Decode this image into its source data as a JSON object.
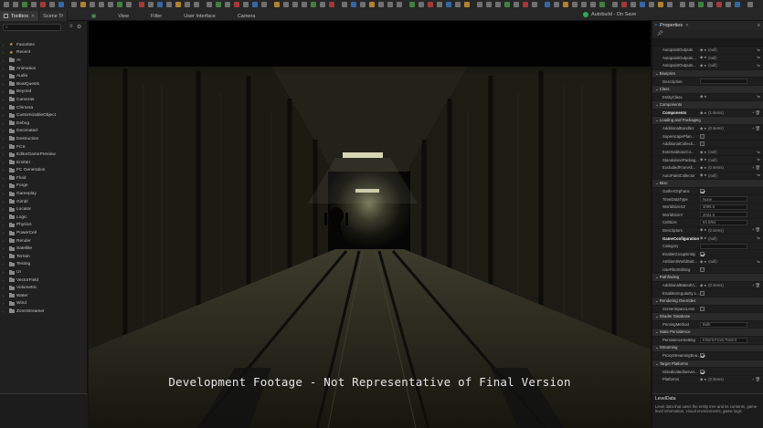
{
  "toolbar": {
    "viewport_menu": [
      "View",
      "Filter",
      "User Interface",
      "Camera"
    ],
    "autobuild": "Autobuild - On Save"
  },
  "toolbox": {
    "tabs": [
      "Toolbox",
      "Scene Tr"
    ],
    "items": [
      {
        "label": "Favorites",
        "icon": "star-icon"
      },
      {
        "label": "Recent",
        "icon": "star-icon"
      },
      {
        "label": "AI",
        "icon": "folder-icon"
      },
      {
        "label": "Animation",
        "icon": "folder-icon"
      },
      {
        "label": "Audio",
        "icon": "folder-icon"
      },
      {
        "label": "BeatQuests",
        "icon": "folder-icon"
      },
      {
        "label": "Beyond",
        "icon": "folder-icon"
      },
      {
        "label": "Cameras",
        "icon": "folder-icon"
      },
      {
        "label": "Chimera",
        "icon": "folder-icon"
      },
      {
        "label": "CustomizableObject",
        "icon": "folder-icon"
      },
      {
        "label": "Debug",
        "icon": "folder-icon"
      },
      {
        "label": "Decimated",
        "icon": "folder-icon"
      },
      {
        "label": "Destruction",
        "icon": "folder-icon"
      },
      {
        "label": "FCS",
        "icon": "folder-icon"
      },
      {
        "label": "EditorGamePreview",
        "icon": "folder-icon"
      },
      {
        "label": "Emitter",
        "icon": "folder-icon"
      },
      {
        "label": "FC Generation",
        "icon": "folder-icon"
      },
      {
        "label": "Fluid",
        "icon": "folder-icon"
      },
      {
        "label": "Forge",
        "icon": "folder-icon"
      },
      {
        "label": "Gameplay",
        "icon": "folder-icon"
      },
      {
        "label": "Gimbl",
        "icon": "folder-icon"
      },
      {
        "label": "Locator",
        "icon": "folder-icon"
      },
      {
        "label": "Logic",
        "icon": "folder-icon"
      },
      {
        "label": "Physics",
        "icon": "folder-icon"
      },
      {
        "label": "PowerCell",
        "icon": "folder-icon"
      },
      {
        "label": "Render",
        "icon": "folder-icon"
      },
      {
        "label": "Satellite",
        "icon": "folder-icon"
      },
      {
        "label": "Terrain",
        "icon": "folder-icon"
      },
      {
        "label": "Testing",
        "icon": "folder-icon"
      },
      {
        "label": "UI",
        "icon": "folder-icon"
      },
      {
        "label": "VectorField",
        "icon": "folder-icon"
      },
      {
        "label": "Volumetric",
        "icon": "folder-icon"
      },
      {
        "label": "Water",
        "icon": "folder-icon"
      },
      {
        "label": "Wind",
        "icon": "folder-icon"
      },
      {
        "label": "ZoneStreamer",
        "icon": "folder-icon"
      }
    ]
  },
  "viewport": {
    "caption": "Development Footage - Not Representative of Final Version"
  },
  "properties": {
    "title": "Properties",
    "rows": [
      {
        "type": "prop",
        "label": "AutopaintOutputs",
        "value": "(null)",
        "kind": "ref"
      },
      {
        "type": "prop",
        "label": "AutopaintOutputs...",
        "value": "(null)",
        "kind": "ref"
      },
      {
        "type": "prop",
        "label": "AutopaintOutputs...",
        "value": "(null)",
        "kind": "ref"
      },
      {
        "type": "cat",
        "label": "Blueprint"
      },
      {
        "type": "prop",
        "label": "Description",
        "value": "",
        "kind": "text"
      },
      {
        "type": "cat",
        "label": "Class"
      },
      {
        "type": "prop",
        "label": "EntityClass",
        "value": "",
        "kind": "ref"
      },
      {
        "type": "cat",
        "label": "Components"
      },
      {
        "type": "prop",
        "label": "Components",
        "value": "(1 items)",
        "kind": "list",
        "bold": true
      },
      {
        "type": "cat",
        "label": "Loading and Packaging"
      },
      {
        "type": "prop",
        "label": "AdditionalBundles",
        "value": "(0 items)",
        "kind": "list"
      },
      {
        "type": "prop",
        "label": "SuperscapePlan...",
        "value": "",
        "kind": "check"
      },
      {
        "type": "prop",
        "label": "AdditionalCollecti...",
        "value": "",
        "kind": "check"
      },
      {
        "type": "prop",
        "label": "ExternalZoneCo...",
        "value": "(null)",
        "kind": "ref"
      },
      {
        "type": "prop",
        "label": "StandalonePackag...",
        "value": "(null)",
        "kind": "ref"
      },
      {
        "type": "prop",
        "label": "ExcludedFromAll...",
        "value": "(0 items)",
        "kind": "list"
      },
      {
        "type": "prop",
        "label": "AutoPaintCollector",
        "value": "(null)",
        "kind": "ref"
      },
      {
        "type": "cat",
        "label": "Misc"
      },
      {
        "type": "prop",
        "label": "GatherOrphans",
        "value": "",
        "kind": "check-on"
      },
      {
        "type": "prop",
        "label": "TimeDataType",
        "value": "None",
        "kind": "select"
      },
      {
        "type": "prop",
        "label": "WorldSizeXZ",
        "value": "4096.0",
        "kind": "text"
      },
      {
        "type": "prop",
        "label": "WorldSizeY",
        "value": "2024.0",
        "kind": "text"
      },
      {
        "type": "prop",
        "label": "CellSize",
        "value": "64.0/64",
        "kind": "text"
      },
      {
        "type": "prop",
        "label": "Descriptors",
        "value": "(0 items)",
        "kind": "list"
      },
      {
        "type": "prop",
        "label": "GameConfiguration",
        "value": "(null)",
        "kind": "ref",
        "bold": true
      },
      {
        "type": "prop",
        "label": "Category",
        "value": "",
        "kind": "text"
      },
      {
        "type": "prop",
        "label": "EnableGroupEntity",
        "value": "",
        "kind": "check-on"
      },
      {
        "type": "prop",
        "label": "AmbientWorldSett...",
        "value": "(null)",
        "kind": "ref"
      },
      {
        "type": "prop",
        "label": "UseFilterEditing",
        "value": "",
        "kind": "check"
      },
      {
        "type": "cat",
        "label": "Pathfinding"
      },
      {
        "type": "prop",
        "label": "AdditionalBakedVi...",
        "value": "(0 items)",
        "kind": "list"
      },
      {
        "type": "prop",
        "label": "EnableIrregularity L...",
        "value": "",
        "kind": "check"
      },
      {
        "type": "cat",
        "label": "Rendering Overrides"
      },
      {
        "type": "prop",
        "label": "ScreenSpaceLens",
        "value": "",
        "kind": "check"
      },
      {
        "type": "cat",
        "label": "Shader Database"
      },
      {
        "type": "prop",
        "label": "PrimingMethod",
        "value": "Bulk",
        "kind": "select"
      },
      {
        "type": "cat",
        "label": "State Persistence"
      },
      {
        "type": "prop",
        "label": "PersistenceSetting",
        "value": "Inherit From Parent",
        "kind": "select"
      },
      {
        "type": "cat",
        "label": "Streaming"
      },
      {
        "type": "prop",
        "label": "ProxyStreamingEna...",
        "value": "",
        "kind": "check-on"
      },
      {
        "type": "cat",
        "label": "Target Platforms"
      },
      {
        "type": "prop",
        "label": "IsDedicatedServer...",
        "value": "",
        "kind": "check-on"
      },
      {
        "type": "prop",
        "label": "Platforms",
        "value": "(0 items)",
        "kind": "list"
      }
    ],
    "desc_title": "LevelData",
    "desc_text": "Level data that owns the entity tree and its contents, game-level information, visual environments, game logic."
  },
  "colors": {
    "accent_green": "#2fa84f",
    "panel": "#1e1e1e",
    "toolbar": "#262626"
  }
}
